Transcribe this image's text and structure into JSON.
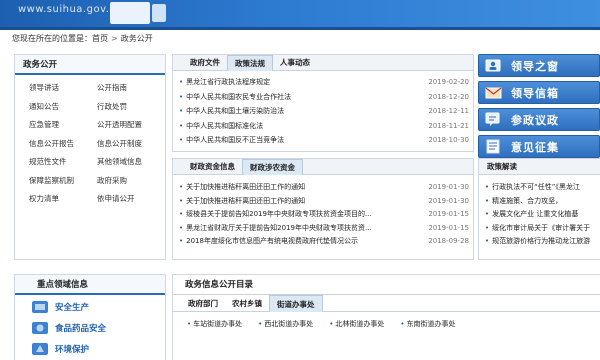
{
  "banner": {
    "url": "www.suihua.gov.cn"
  },
  "breadcrumb": {
    "prefix": "您现在所在的位置是：",
    "home": "首页",
    "separator": ">",
    "current": "政务公开"
  },
  "left_panel": {
    "title": "政务公开",
    "items": [
      "领导讲话",
      "公开指南",
      "通知公告",
      "行政处罚",
      "应急管理",
      "公开透明配置",
      "信息公开报告",
      "信息公开制度",
      "规范性文件",
      "其他领域信息",
      "保障监察机制",
      "政府采购",
      "权力清单",
      "依申请公开"
    ]
  },
  "policy_panel": {
    "tabs": [
      "政府文件",
      "政策法规",
      "人事动态"
    ],
    "active_tab": 1,
    "rows": [
      {
        "title": "黑龙江省行政执法程序规定",
        "date": "2019-02-20"
      },
      {
        "title": "中华人民共和国农民专业合作社法",
        "date": "2018-12-20"
      },
      {
        "title": "中华人民共和国土壤污染防治法",
        "date": "2018-12-11"
      },
      {
        "title": "中华人民共和国标准化法",
        "date": "2018-11-21"
      },
      {
        "title": "中华人民共和国反不正当竞争法",
        "date": "2018-10-30"
      }
    ]
  },
  "finance_panel": {
    "tabs": [
      "财政资金信息",
      "财政涉农资金"
    ],
    "active_tab": 1,
    "rows": [
      {
        "title": "关于加快推进秸秆离田还田工作的通知",
        "date": "2019-01-30"
      },
      {
        "title": "关于加快推进秸秆离田还田工作的通知",
        "date": "2019-01-30"
      },
      {
        "title": "绥棱县关于提前告知2019年中央财政专项扶贫资金项目的...",
        "date": "2019-01-15"
      },
      {
        "title": "黑龙江省财政厅关于提前告知2019年中央财政专项扶贫资...",
        "date": "2019-01-15"
      },
      {
        "title": "2018年度绥化市信息图产有统电视费政府代垫情况公示",
        "date": "2018-09-28"
      }
    ]
  },
  "quick_links": [
    {
      "label": "领导之窗",
      "icon": "leader-icon"
    },
    {
      "label": "领导信箱",
      "icon": "mailbox-icon"
    },
    {
      "label": "参政议政",
      "icon": "discussion-icon"
    },
    {
      "label": "意见征集",
      "icon": "feedback-icon"
    }
  ],
  "policy_interpretation": {
    "title": "政策解读",
    "items": [
      "行政执法不可“任性”《黑龙江",
      "精准施策、合力攻坚，",
      "发展文化产业 让重文化植基",
      "绥化市审计局关于《审计署关于",
      "规范旅游价格行为推动龙江旅游"
    ]
  },
  "focus_info": {
    "title": "重点领域信息",
    "items": [
      {
        "label": "安全生产",
        "icon": "safety-icon"
      },
      {
        "label": "食品药品安全",
        "icon": "food-drug-icon"
      },
      {
        "label": "环境保护",
        "icon": "environment-icon"
      }
    ]
  },
  "directory": {
    "title": "政务信息公开目录",
    "tabs": [
      "政府部门",
      "农村乡镇",
      "街道办事处"
    ],
    "active_tab": 2,
    "items": [
      "车站街道办事处",
      "西北街道办事处",
      "北林街道办事处",
      "东南街道办事处"
    ]
  },
  "colors": {
    "primary": "#2b6cb8",
    "banner": "#1d5fb0",
    "link_bullet": "#1f5fa8"
  }
}
